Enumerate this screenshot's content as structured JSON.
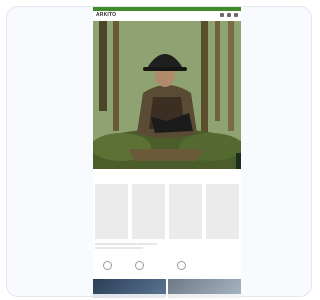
{
  "header": {
    "logo": "ARKITO",
    "nav_icons": [
      "search-icon",
      "account-icon",
      "cart-icon",
      "menu-icon"
    ]
  },
  "hero": {
    "headline_lines": [
      "",
      "",
      ""
    ]
  },
  "sections": {
    "product_cards": 4,
    "feature_icons": [
      "shipping-icon",
      "returns-icon",
      "secure-icon"
    ]
  },
  "colors": {
    "accent": "#3f8a2a",
    "forest_dark": "#2f3b1f"
  }
}
